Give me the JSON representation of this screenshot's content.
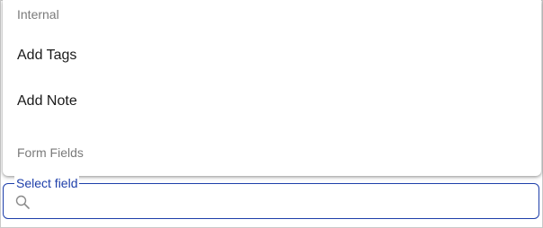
{
  "menu": {
    "sections": [
      {
        "header": "Internal",
        "items": [
          {
            "label": "Add Tags"
          },
          {
            "label": "Add Note"
          }
        ]
      },
      {
        "header": "Form Fields",
        "items": []
      }
    ]
  },
  "select_field": {
    "label": "Select field",
    "value": "",
    "placeholder": "",
    "icon": "search-icon"
  },
  "colors": {
    "accent": "#1e3faa",
    "header_text": "#7a7a7a",
    "item_text": "#1a1a1a"
  }
}
